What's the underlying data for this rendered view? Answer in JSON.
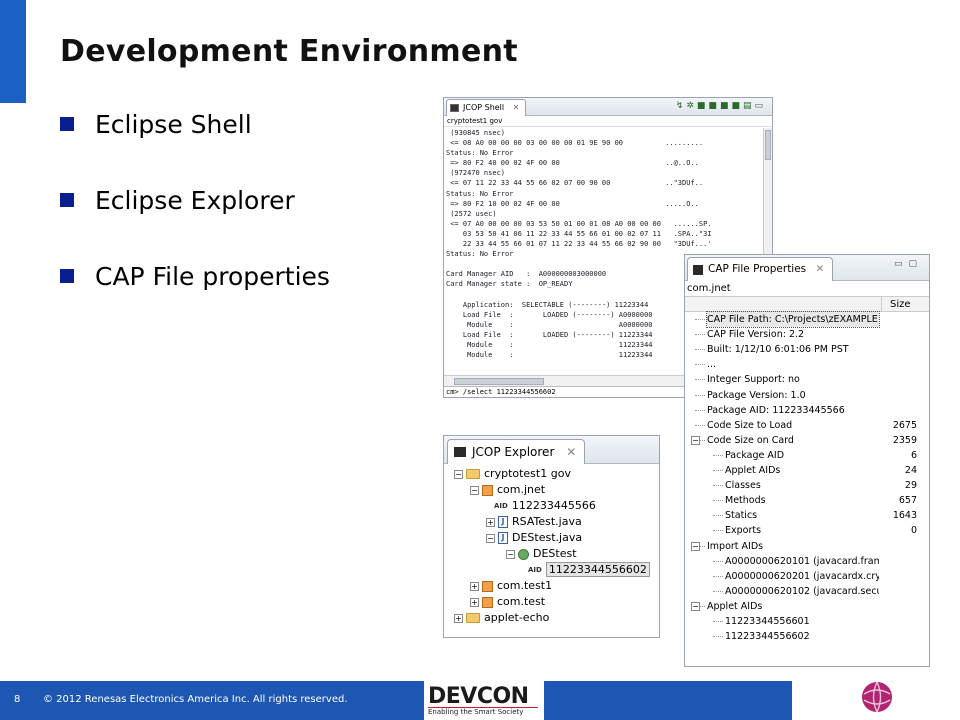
{
  "slide": {
    "title": "Development Environment",
    "bullets": [
      "Eclipse Shell",
      "Eclipse Explorer",
      "CAP File properties"
    ],
    "colors": {
      "accent": "#1b60c5",
      "bullet": "#0a1f8f",
      "footer": "#1e57b3",
      "brand_red": "#c31f2a"
    }
  },
  "shell": {
    "tab_label": "JCOP Shell",
    "subtitle": "cryptotest1 gov",
    "lines": [
      " (930845 nsec)",
      " <= 08 A0 00 00 00 03 00 00 00 01 9E 90 00          .........",
      "Status: No Error",
      " => 80 F2 40 00 02 4F 00 00                         ..@..O..",
      " (972470 nsec)",
      " <= 07 11 22 33 44 55 66 02 07 00 90 00             ..\"3DUf..",
      "Status: No Error",
      " => 80 F2 10 00 02 4F 00 00                         .....O..",
      " (2572 usec)",
      " <= 07 A0 00 00 00 03 53 50 01 00 01 08 A0 00 00 00   ......SP.",
      "    03 53 50 41 06 11 22 33 44 55 66 01 00 02 07 11   .SPA..\"3I",
      "    22 33 44 55 66 01 07 11 22 33 44 55 66 02 90 00   \"3DUf...'",
      "Status: No Error",
      "",
      "Card Manager AID   :  A000000003000000",
      "Card Manager state :  OP_READY",
      "",
      "    Application:  SELECTABLE (--------) 11223344",
      "    Load File  :       LOADED (--------) A0000000",
      "     Module    :                         A0000000",
      "    Load File  :       LOADED (--------) 11223344",
      "     Module    :                         11223344",
      "     Module    :                         11223344"
    ],
    "command": "cm> /select 11223344556602"
  },
  "explorer": {
    "tab_label": "JCOP Explorer",
    "tree": [
      {
        "label": "cryptotest1 gov",
        "icon": "folder-icon",
        "expander": "−"
      },
      {
        "label": "com.jnet",
        "icon": "package-icon",
        "expander": "−"
      },
      {
        "label": "112233445566",
        "icon": "aid-icon",
        "expander": ""
      },
      {
        "label": "RSATest.java",
        "icon": "java-file-icon",
        "expander": "+"
      },
      {
        "label": "DEStest.java",
        "icon": "java-file-icon",
        "expander": "−"
      },
      {
        "label": "DEStest",
        "icon": "applet-class-icon",
        "expander": "−"
      },
      {
        "label": "11223344556602",
        "icon": "aid-icon",
        "expander": ""
      },
      {
        "label": "com.test1",
        "icon": "package-icon",
        "expander": "+"
      },
      {
        "label": "com.test",
        "icon": "package-icon",
        "expander": "+"
      },
      {
        "label": "applet-echo",
        "icon": "folder-icon",
        "expander": "+"
      }
    ],
    "aid_tag": "AID"
  },
  "cap": {
    "tab_label": "CAP File Properties",
    "path": "com.jnet",
    "column_size": "Size",
    "rows": [
      {
        "label": "CAP File Path: C:\\Projects\\zEXAMPLE",
        "size": ""
      },
      {
        "label": "CAP File Version: 2.2",
        "size": ""
      },
      {
        "label": "Built: 1/12/10 6:01:06 PM PST",
        "size": ""
      },
      {
        "label": "...",
        "size": ""
      },
      {
        "label": "Integer Support: no",
        "size": ""
      },
      {
        "label": "Package Version: 1.0",
        "size": ""
      },
      {
        "label": "Package AID: 112233445566",
        "size": ""
      },
      {
        "label": "Code Size to Load",
        "size": "2675"
      },
      {
        "label": "Code Size on Card",
        "size": "2359"
      },
      {
        "label": "Package AID",
        "size": "6"
      },
      {
        "label": "Applet AIDs",
        "size": "24"
      },
      {
        "label": "Classes",
        "size": "29"
      },
      {
        "label": "Methods",
        "size": "657"
      },
      {
        "label": "Statics",
        "size": "1643"
      },
      {
        "label": "Exports",
        "size": "0"
      },
      {
        "label": "Import AIDs",
        "size": ""
      },
      {
        "label": "A0000000620101 (javacard.framew",
        "size": ""
      },
      {
        "label": "A0000000620201 (javacardx.crypt",
        "size": ""
      },
      {
        "label": "A0000000620102 (javacard.securi",
        "size": ""
      },
      {
        "label": "Applet AIDs",
        "size": ""
      },
      {
        "label": "11223344556601",
        "size": ""
      },
      {
        "label": "11223344556602",
        "size": ""
      }
    ]
  },
  "footer": {
    "page": "8",
    "copyright": "© 2012 Renesas Electronics America Inc. All rights reserved.",
    "devcon_name": "DEVCON",
    "devcon_tagline": "Enabling the Smart Society"
  }
}
